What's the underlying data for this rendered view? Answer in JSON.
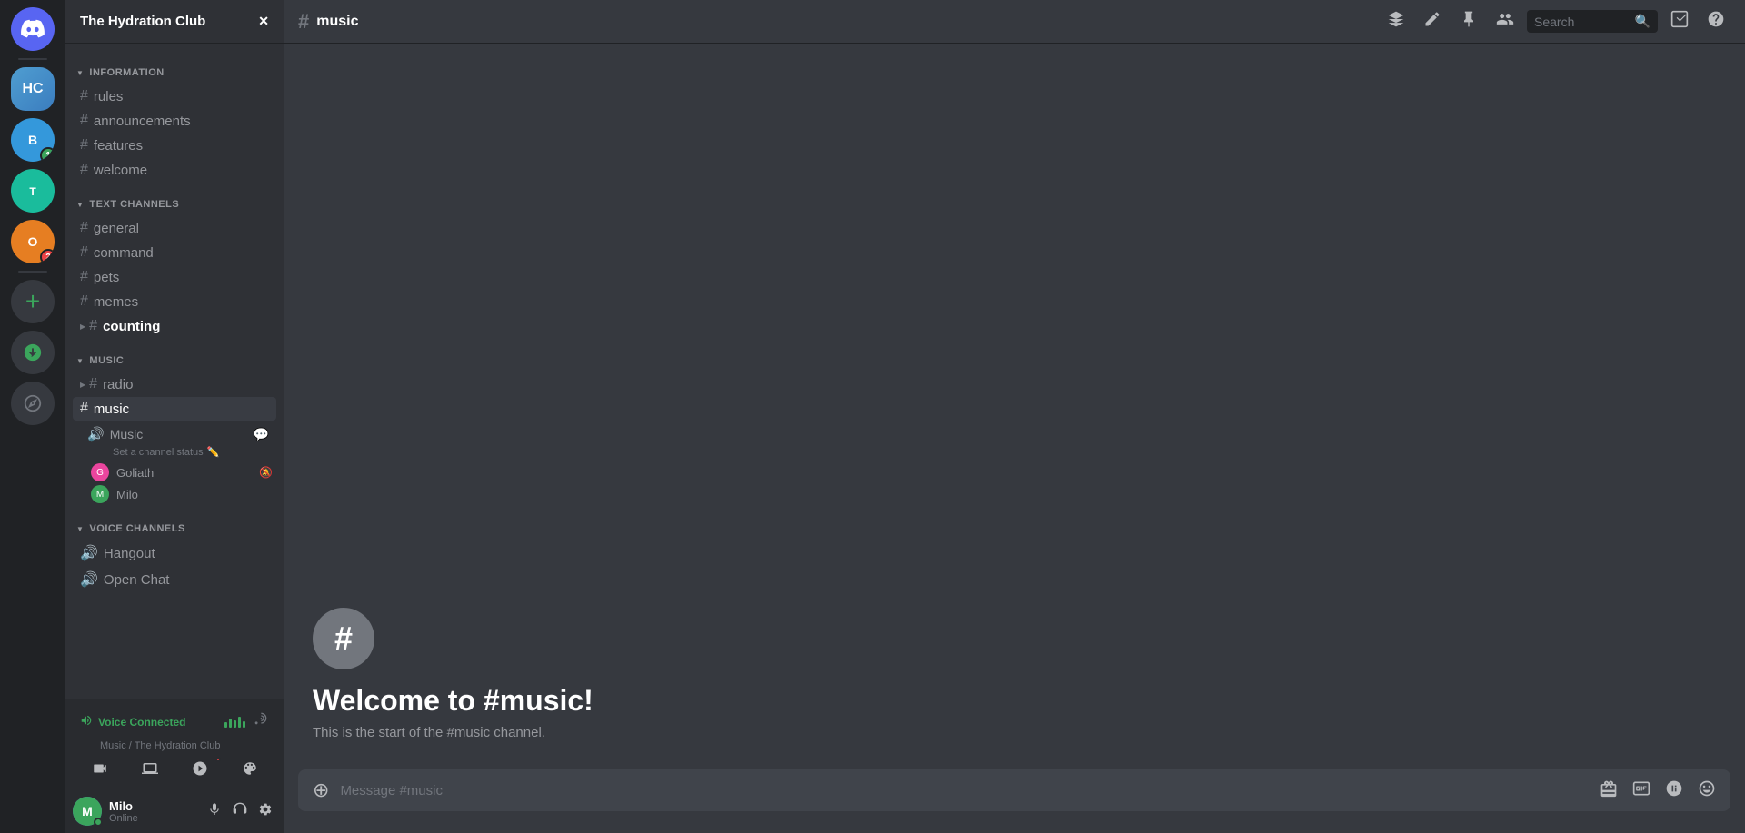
{
  "server": {
    "name": "The Hydration Club",
    "icon_label": "H"
  },
  "current_channel": "music",
  "channel_title": "#music",
  "welcome": {
    "title": "Welcome to #music!",
    "description": "This is the start of the #music channel."
  },
  "message_placeholder": "Message #music",
  "categories": {
    "information": {
      "label": "INFORMATION",
      "channels": [
        {
          "name": "rules",
          "type": "text"
        },
        {
          "name": "announcements",
          "type": "text"
        },
        {
          "name": "features",
          "type": "text"
        },
        {
          "name": "welcome",
          "type": "text"
        }
      ]
    },
    "text_channels": {
      "label": "TEXT CHANNELS",
      "channels": [
        {
          "name": "general",
          "type": "text"
        },
        {
          "name": "command",
          "type": "text"
        },
        {
          "name": "pets",
          "type": "text"
        },
        {
          "name": "memes",
          "type": "text"
        },
        {
          "name": "counting",
          "type": "text",
          "bold": true
        }
      ]
    },
    "music": {
      "label": "MUSIC",
      "channels": [
        {
          "name": "radio",
          "type": "text_with_expand"
        },
        {
          "name": "music",
          "type": "active_voice"
        }
      ]
    },
    "voice_channels": {
      "label": "VOICE CHANNELS",
      "channels": [
        {
          "name": "Hangout",
          "type": "voice"
        },
        {
          "name": "Open Chat",
          "type": "voice"
        }
      ]
    }
  },
  "music_channel": {
    "name": "Music",
    "status_text": "Set a channel status",
    "users": [
      {
        "name": "Goliath",
        "avatar_color": "#eb459e"
      },
      {
        "name": "Milo",
        "avatar_color": "#3ba55c"
      }
    ]
  },
  "voice_connected": {
    "status": "Voice Connected",
    "context": "Music / The Hydration Club"
  },
  "user": {
    "name": "Milo",
    "status": "Online",
    "avatar_color": "#3ba55c",
    "avatar_letter": "M"
  },
  "top_bar_icons": {
    "pin": "📌",
    "mention": "@",
    "members": "👥",
    "threads": "🧵"
  },
  "search": {
    "placeholder": "Search"
  },
  "servers": [
    {
      "id": "discord-home",
      "label": "DC",
      "color": "#5865f2",
      "type": "discord"
    },
    {
      "id": "hydration",
      "label": "H",
      "color": "#4f9ed1",
      "type": "avatar"
    },
    {
      "id": "blue1",
      "label": "B",
      "color": "#3498db",
      "type": "avatar",
      "badge": "1"
    },
    {
      "id": "teal1",
      "label": "T",
      "color": "#1abc9c",
      "type": "avatar"
    },
    {
      "id": "orange1",
      "label": "O",
      "color": "#e67e22",
      "type": "avatar",
      "badge": "2"
    },
    {
      "id": "add",
      "label": "+",
      "color": "#36393f",
      "type": "add"
    },
    {
      "id": "download",
      "label": "↓",
      "color": "#36393f",
      "type": "download"
    },
    {
      "id": "explore",
      "label": "🧭",
      "color": "#36393f",
      "type": "explore"
    }
  ]
}
